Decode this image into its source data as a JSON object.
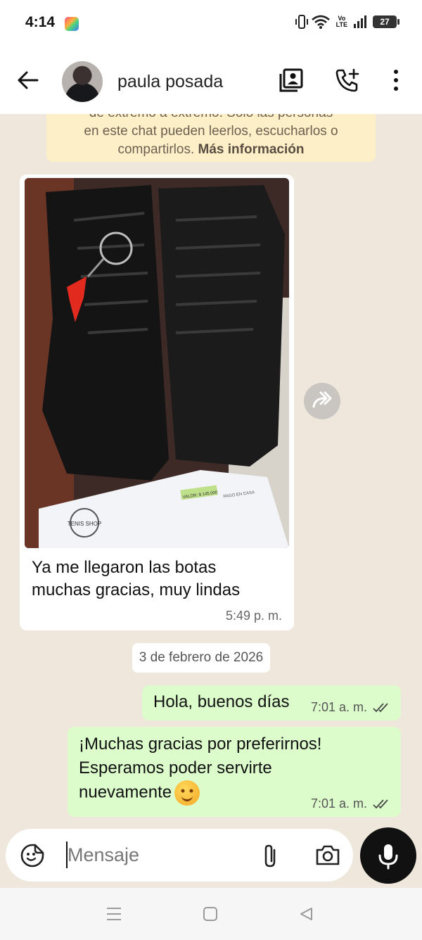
{
  "status_bar": {
    "time": "4:14",
    "volte_line1": "Vo",
    "volte_line2": "LTE",
    "battery": "27"
  },
  "header": {
    "contact_name": "paula posada",
    "icons": [
      "back-arrow-icon",
      "contact-card-icon",
      "add-call-icon",
      "more-vertical-icon"
    ]
  },
  "encryption_notice": {
    "line_cut": "de extremo a extremo. Solo las personas",
    "line_2": "en este chat pueden leerlos, escucharlos o",
    "line_3_prefix": "compartirlos.",
    "link": "Más información"
  },
  "incoming_message": {
    "text_line_1": "Ya me llegaron las botas",
    "text_line_2": "muchas gracias, muy lindas",
    "time": "5:49 p. m.",
    "photo_label": "TENIS SHOP",
    "photo_receipt_label": "VALOR: $ 145.000",
    "photo_receipt_note": "PAGO EN CASA"
  },
  "date_separator": "3 de febrero de 2026",
  "outgoing_messages": [
    {
      "text": "Hola, buenos días",
      "time": "7:01 a. m."
    },
    {
      "line_1": "¡Muchas gracias por preferirnos!",
      "line_2": "Esperamos poder servirte",
      "line_3": "nuevamente",
      "time": "7:01 a. m."
    }
  ],
  "composer": {
    "placeholder": "Mensaje"
  },
  "colors": {
    "chat_background": "#efe7db",
    "outgoing_bubble": "#dcfccb",
    "notice_background": "#fdefc8",
    "mic_button": "#111111"
  }
}
